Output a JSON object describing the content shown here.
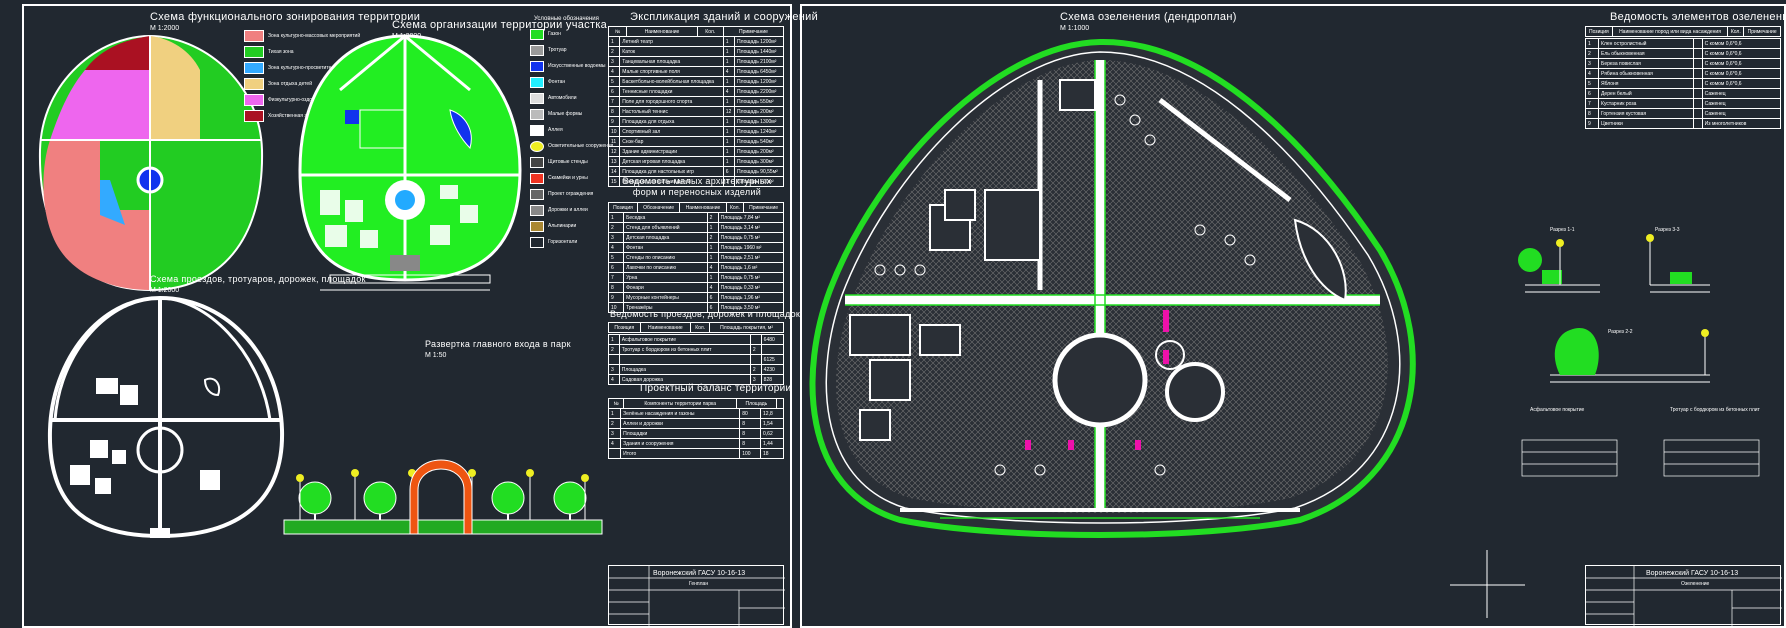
{
  "sheet1": {
    "zoning": {
      "title": "Схема функционального зонирования территории",
      "scale": "М 1:2000",
      "legend": [
        {
          "label": "Зона культурно-массовых мероприятий",
          "color": "#f08080"
        },
        {
          "label": "Тихая зона",
          "color": "#22cc22"
        },
        {
          "label": "Зона культурно-просветительских учреждений",
          "color": "#33aaff"
        },
        {
          "label": "Зона отдыха детей",
          "color": "#f0d080"
        },
        {
          "label": "Физкультурно-оздоровительная зона",
          "color": "#ee66ee"
        },
        {
          "label": "Хозяйственная зона",
          "color": "#aa1122"
        }
      ]
    },
    "organization": {
      "title": "Схема организации территории участка",
      "scale": "М 1:2000"
    },
    "conventions": {
      "title": "Условные обозначения",
      "items": [
        "Газон",
        "Тротуар",
        "Искусственные водоемы",
        "Фонтан",
        "Автомобили",
        "Малые формы",
        "Аллея",
        "Осветительные сооружения",
        "Щитовые стенды",
        "Скамейки и урны",
        "Проект ограждения",
        "Дорожки и аллеи",
        "Альпинарии",
        "Горизонтали"
      ]
    },
    "explication": {
      "title": "Экспликация зданий и сооружений",
      "headers": [
        "№",
        "Наименование",
        "Кол.",
        "Примечание"
      ],
      "rows": [
        [
          "1",
          "Летний театр",
          "1",
          "Площадь 1200м²"
        ],
        [
          "2",
          "Каток",
          "1",
          "Площадь 1440м²"
        ],
        [
          "3",
          "Танцевальная площадка",
          "1",
          "Площадь 2100м²"
        ],
        [
          "4",
          "Малые спортивные поля",
          "4",
          "Площадь 6450м²"
        ],
        [
          "5",
          "Баскетбольно-волейбольная площадка",
          "1",
          "Площадь 1200м²"
        ],
        [
          "6",
          "Теннисные площадки",
          "4",
          "Площадь 2200м²"
        ],
        [
          "7",
          "Поле для городошного спорта",
          "1",
          "Площадь 550м²"
        ],
        [
          "8",
          "Настольный теннис",
          "12",
          "Площадь 200м²"
        ],
        [
          "9",
          "Площадка для отдыха",
          "1",
          "Площадь 1300м²"
        ],
        [
          "10",
          "Спортивный зал",
          "1",
          "Площадь 1240м²"
        ],
        [
          "11",
          "Снэк-бар",
          "1",
          "Площадь 540м²"
        ],
        [
          "12",
          "Здание администрации",
          "1",
          "Площадь 200м²"
        ],
        [
          "13",
          "Детская игровая площадка",
          "1",
          "Площадь 300м²"
        ],
        [
          "14",
          "Площадка для настольных игр",
          "6",
          "Площадь 90,55м²"
        ],
        [
          "15",
          "Площадка для катания детей",
          "1",
          "Площадь 700м²"
        ]
      ]
    },
    "small_forms": {
      "title": "Ведомость малых архитектурных форм и переносных изделий",
      "headers": [
        "Позиция",
        "Обозначение",
        "Наименование",
        "Кол.",
        "Примечание"
      ],
      "rows": [
        [
          "1",
          "Беседка",
          "2",
          "Площадь 7,84 м²"
        ],
        [
          "2",
          "Стенд для объявлений",
          "1",
          "Площадь 3,14 м²"
        ],
        [
          "3",
          "Детская площадка",
          "2",
          "Площадь 0,75 м²"
        ],
        [
          "4",
          "Фонтан",
          "1",
          "Площадь 1960 м²"
        ],
        [
          "5",
          "Стенды по описанию",
          "1",
          "Площадь 2,51 м²"
        ],
        [
          "6",
          "Лавочки по описанию",
          "4",
          "Площадь 1,6 м²"
        ],
        [
          "7",
          "Урна",
          "1",
          "Площадь 0,75 м²"
        ],
        [
          "8",
          "Фонари",
          "4",
          "Площадь 0,33 м²"
        ],
        [
          "9",
          "Мусорные контейнеры",
          "6",
          "Площадь 1,96 м²"
        ],
        [
          "10",
          "Тренажёры",
          "6",
          "Площадь 3,50 м²"
        ]
      ]
    },
    "roads": {
      "title": "Ведомость проездов, дорожек и площадок",
      "headers": [
        "Позиция",
        "Наименование",
        "Кол.",
        "Площадь покрытия, м²"
      ],
      "rows": [
        [
          "1",
          "Асфальтовое покрытие",
          "",
          "6480"
        ],
        [
          "2",
          "Тротуар с бордюром из бетонных плит",
          "2",
          ""
        ],
        [
          "",
          "",
          "",
          "6125"
        ],
        [
          "3",
          "Площадка",
          "2",
          "4230"
        ],
        [
          "4",
          "Садовая дорожка",
          "3",
          "828"
        ]
      ]
    },
    "balance": {
      "title": "Проектный баланс территории",
      "headers": [
        "№",
        "Компоненты территории парка",
        "Площадь",
        ""
      ],
      "rows": [
        [
          "1",
          "Зелёные насаждения и газоны",
          "80",
          "12,8"
        ],
        [
          "2",
          "Аллеи и дорожки",
          "8",
          "1,54"
        ],
        [
          "3",
          "Площадки",
          "8",
          "0,62"
        ],
        [
          "4",
          "Здания и сооружения",
          "8",
          "1,44"
        ],
        [
          "",
          "Итого",
          "100",
          "18"
        ]
      ]
    },
    "paths": {
      "title": "Схема проездов, тротуаров, дорожек, площадок",
      "scale": "М 1:2000"
    },
    "entrance": {
      "title": "Развертка главного входа в парк",
      "scale": "М 1:50"
    },
    "stamp": {
      "org": "Воронежский ГАСУ 10-16-13",
      "name": "Генплан"
    }
  },
  "sheet2": {
    "greening": {
      "title": "Схема озеленения (дендроплан)",
      "scale": "М 1:1000"
    },
    "elements": {
      "title": "Ведомость элементов озеленения",
      "headers": [
        "Позиция",
        "Наименование пород или вида насаждения",
        "Кол.",
        "Примечание"
      ],
      "rows": [
        [
          "1",
          "Клен остролистный",
          "",
          "С комом 0,6*0,6"
        ],
        [
          "2",
          "Ель обыкновенная",
          "",
          "С комом 0,6*0,6"
        ],
        [
          "3",
          "Береза повислая",
          "",
          "С комом 0,6*0,6"
        ],
        [
          "4",
          "Рябина обыкновенная",
          "",
          "С комом 0,6*0,6"
        ],
        [
          "5",
          "Яблоня",
          "",
          "С комом 0,6*0,6"
        ],
        [
          "6",
          "Дерен белый",
          "",
          "Саженец"
        ],
        [
          "7",
          "Кустарник роза",
          "",
          "Саженец"
        ],
        [
          "8",
          "Гортензия кустовая",
          "",
          "Саженец"
        ],
        [
          "9",
          "Цветники",
          "",
          "Из многолетников"
        ]
      ]
    },
    "sections": [
      "Разрез 1-1",
      "Разрез 3-3",
      "Разрез 2-2"
    ],
    "pavement": {
      "left": "Асфальтовое покрытие",
      "right": "Тротуар с бордюром из бетонных плит"
    },
    "stamp": {
      "org": "Воронежский ГАСУ 10-16-13",
      "name": "Озеленение"
    }
  },
  "colors": {
    "background": "#212830",
    "green": "#22dd22",
    "line": "#ffffff",
    "orange": "#ee5511",
    "blue": "#1133ee",
    "magenta": "#ee11aa"
  }
}
